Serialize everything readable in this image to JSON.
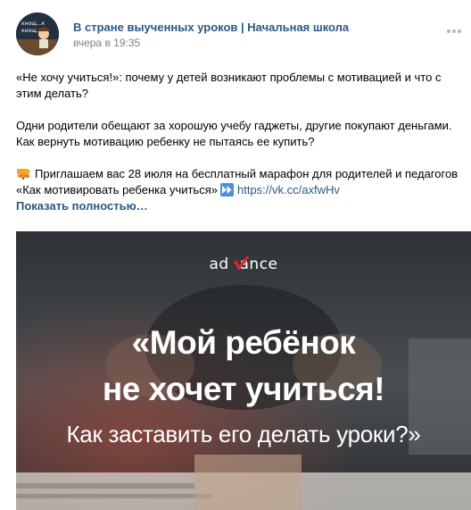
{
  "post": {
    "group_name": "В стране выученных уроков | Начальная школа",
    "time": "вчера в 19:35",
    "lines": {
      "l1": "«Не хочу учиться!»: почему у детей возникают проблемы с мотивацией и что с",
      "l2": "этим делать?",
      "l3": "Одни родители обещают за хорошую учебу гаджеты, другие покупают деньгами.",
      "l4": "Как вернуть мотивацию ребенку не пытаясь ее купить?",
      "l5": "Приглашаем вас 28 июля на бесплатный марафон для родителей и педагогов",
      "l6": "«Как мотивировать ребенка учиться»",
      "link": "https://vk.cc/axfwHv",
      "show_more": "Показать полностью…"
    }
  },
  "image": {
    "brand": "advance",
    "headline_1": "«Мой ребёнок",
    "headline_2": "не хочет учиться!",
    "subheadline": "Как заставить его делать уроки?»"
  },
  "icons": {
    "more": "more-horizontal-icon",
    "sign": "signpost-emoji-icon",
    "fast_forward": "fast-forward-emoji-icon"
  },
  "colors": {
    "link": "#2a5885",
    "time": "#828282",
    "brand_check": "#e5232d"
  }
}
